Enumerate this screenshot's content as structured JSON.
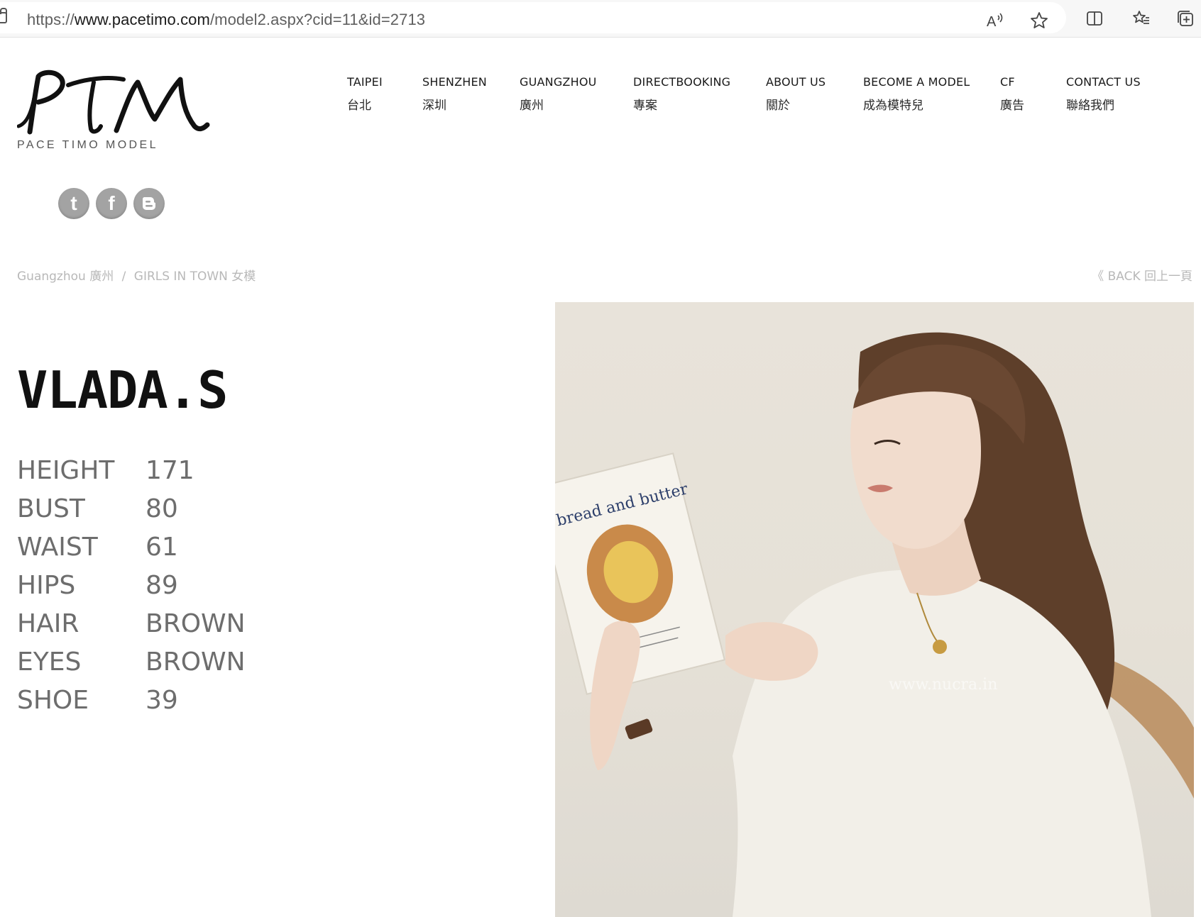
{
  "browser": {
    "url_prefix": "https://",
    "url_host": "www.pacetimo.com",
    "url_path": "/model2.aspx?cid=11&id=2713",
    "icons": [
      "read-aloud-icon",
      "favorite-star-icon",
      "split-screen-icon",
      "favorites-icon",
      "collections-icon"
    ]
  },
  "logo": {
    "mark": "PTM",
    "subtitle": "PACE TIMO MODEL"
  },
  "nav": [
    {
      "en": "TAIPEI",
      "zh": "台北"
    },
    {
      "en": "SHENZHEN",
      "zh": "深圳"
    },
    {
      "en": "GUANGZHOU",
      "zh": "廣州"
    },
    {
      "en": "DIRECTBOOKING",
      "zh": "專案"
    },
    {
      "en": "ABOUT US",
      "zh": "關於"
    },
    {
      "en": "BECOME A MODEL",
      "zh": "成為模特兒"
    },
    {
      "en": "CF",
      "zh": "廣告"
    },
    {
      "en": "CONTACT US",
      "zh": "聯絡我們"
    }
  ],
  "social": [
    {
      "name": "tumblr",
      "glyph": "t"
    },
    {
      "name": "facebook",
      "glyph": "f"
    },
    {
      "name": "blogger",
      "glyph": "B"
    }
  ],
  "breadcrumb": {
    "city": "Guangzhou 廣州",
    "separator": "/",
    "category": "GIRLS IN TOWN 女模"
  },
  "back_label": "《 BACK 回上一頁",
  "model": {
    "name": "VLADA.S",
    "stats": [
      {
        "label": "HEIGHT",
        "value": "171"
      },
      {
        "label": "BUST",
        "value": "80"
      },
      {
        "label": "WAIST",
        "value": "61"
      },
      {
        "label": "HIPS",
        "value": "89"
      },
      {
        "label": "HAIR",
        "value": "BROWN"
      },
      {
        "label": "EYES",
        "value": "BROWN"
      },
      {
        "label": "SHOE",
        "value": "39"
      }
    ]
  },
  "photo": {
    "book_title": "bread and butter",
    "watermark": "www.nucra.in"
  },
  "colors": {
    "accent_gray": "#a3a3a3",
    "muted_text": "#b8b8b8",
    "stat_text": "#6d6d6d"
  }
}
